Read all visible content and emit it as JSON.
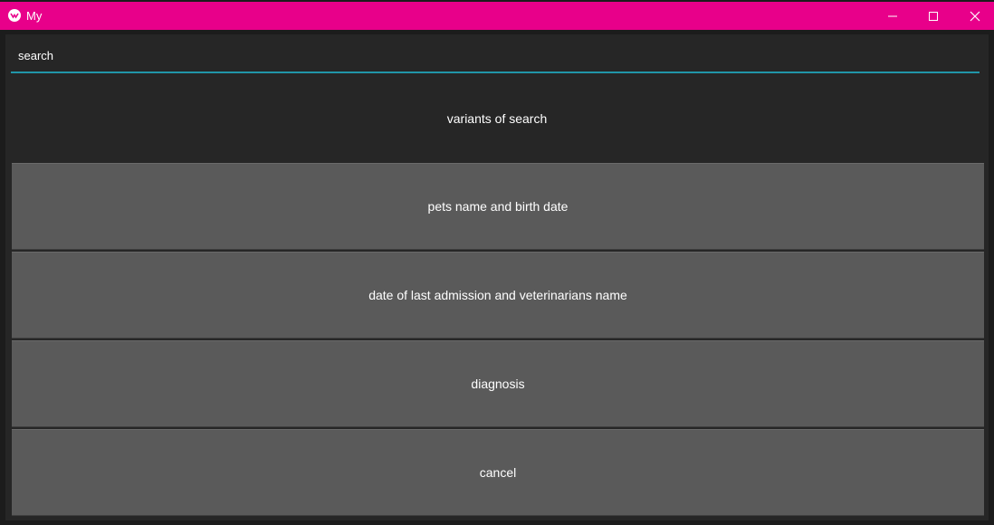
{
  "window": {
    "title": "My",
    "titlebar_color": "#e8008a",
    "icons": {
      "app": "kivy-logo-icon",
      "minimize": "minimize-icon",
      "maximize": "maximize-icon",
      "close": "close-icon"
    }
  },
  "search": {
    "value": "search",
    "accent_color": "#2196a8"
  },
  "variants_label": "variants of search",
  "options": [
    "pets name and birth date",
    "date of last admission and veterinarians name",
    "diagnosis",
    "cancel"
  ],
  "colors": {
    "background": "#262626",
    "button": "#5a5a5a"
  }
}
